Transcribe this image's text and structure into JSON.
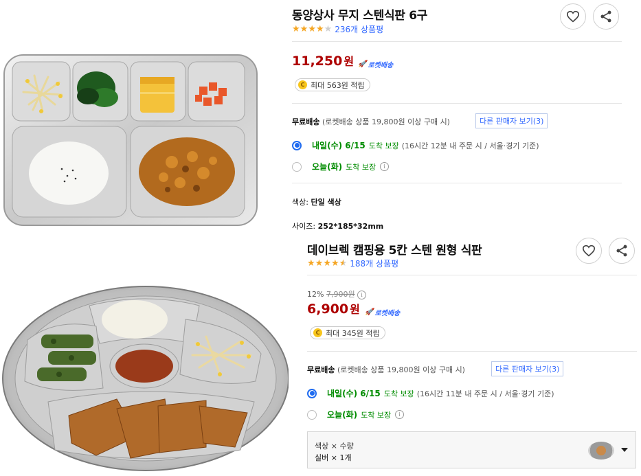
{
  "product1": {
    "title": "동양상사 무지 스텐식판 6구",
    "rating": 4,
    "reviews": "236개 상품평",
    "price": "11,250",
    "price_unit": "원",
    "rocket_label": "로켓배송",
    "reward": "최대 563원 적립",
    "shipping_label": "무료배송",
    "shipping_note": "(로켓배송 상품 19,800원 이상 구매 시)",
    "other_sellers": "다른 판매자 보기(3)",
    "delivery_option1_main": "내일(수) 6/15",
    "delivery_option1_suffix": "도착 보장",
    "delivery_option1_note": "(16시간 12분 내 주문 시 / 서울⋅경기 기준)",
    "delivery_option2_main": "오늘(화)",
    "delivery_option2_suffix": "도착 보장",
    "color_label": "색상:",
    "color_value": "단일 색상",
    "size_label": "사이즈:",
    "size_value": "252*185*32mm",
    "image_label": "stainless steel 6-compartment tray with food"
  },
  "product2": {
    "title": "데이브렉 캠핑용 5칸 스텐 원형 식판",
    "rating": 4.5,
    "reviews": "188개 상품평",
    "discount": "12%",
    "original_price": "7,900원",
    "price": "6,900",
    "price_unit": "원",
    "rocket_label": "로켓배송",
    "reward": "최대 345원 적립",
    "shipping_label": "무료배송",
    "shipping_note": "(로켓배송 상품 19,800원 이상 구매 시)",
    "other_sellers": "다른 판매자 보기(3)",
    "delivery_option1_main": "내일(수) 6/15",
    "delivery_option1_suffix": "도착 보장",
    "delivery_option1_note": "(16시간 11분 내 주문 시 / 서울⋅경기 기준)",
    "delivery_option2_main": "오늘(화)",
    "delivery_option2_suffix": "도착 보장",
    "option_header": "색상 × 수량",
    "option_value": "실버 × 1개",
    "image_label": "round stainless steel 5-compartment tray with food"
  },
  "icons": {
    "heart": "heart-icon",
    "share": "share-icon",
    "rocket": "rocket-icon",
    "coin": "coin-icon",
    "info": "info-icon",
    "dropdown": "chevron-down-icon"
  },
  "colors": {
    "price": "#ae0000",
    "link": "#346aff",
    "delivery": "#008c00",
    "star": "#f5a623",
    "radio": "#1f6bf0"
  }
}
